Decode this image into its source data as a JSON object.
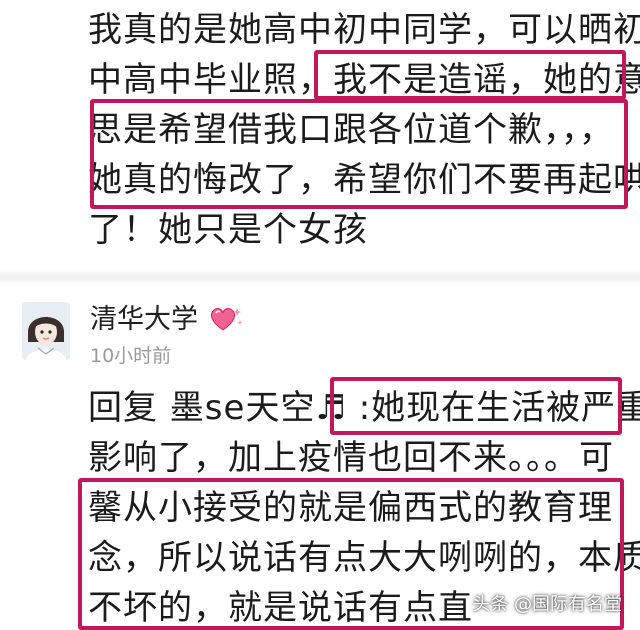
{
  "comment_top": {
    "lines": [
      "我真的是她高中初中同学，可以晒初",
      "中高中毕业照，我不是造谣，她的意",
      "思是希望借我口跟各位道个歉，，，",
      "她真的悔改了，希望你们不要再起哄",
      "了！她只是个女孩"
    ]
  },
  "comment_bottom": {
    "username": "清华大学",
    "username_badge_icon": "heart-sparkle-icon",
    "time": "10小时前",
    "lines": [
      "回复 墨se天空♬ :她现在生活被严重",
      "影响了，加上疫情也回不来。。。可",
      "馨从小接受的就是偏西式的教育理",
      "念，所以说话有点大大咧咧的，本质",
      "不坏的，就是说话有点直"
    ]
  },
  "watermark": "头条 @国际有名堂",
  "colors": {
    "highlight": "#c2185b",
    "timestamp": "#9a9a9a",
    "heart": "#f06292"
  }
}
